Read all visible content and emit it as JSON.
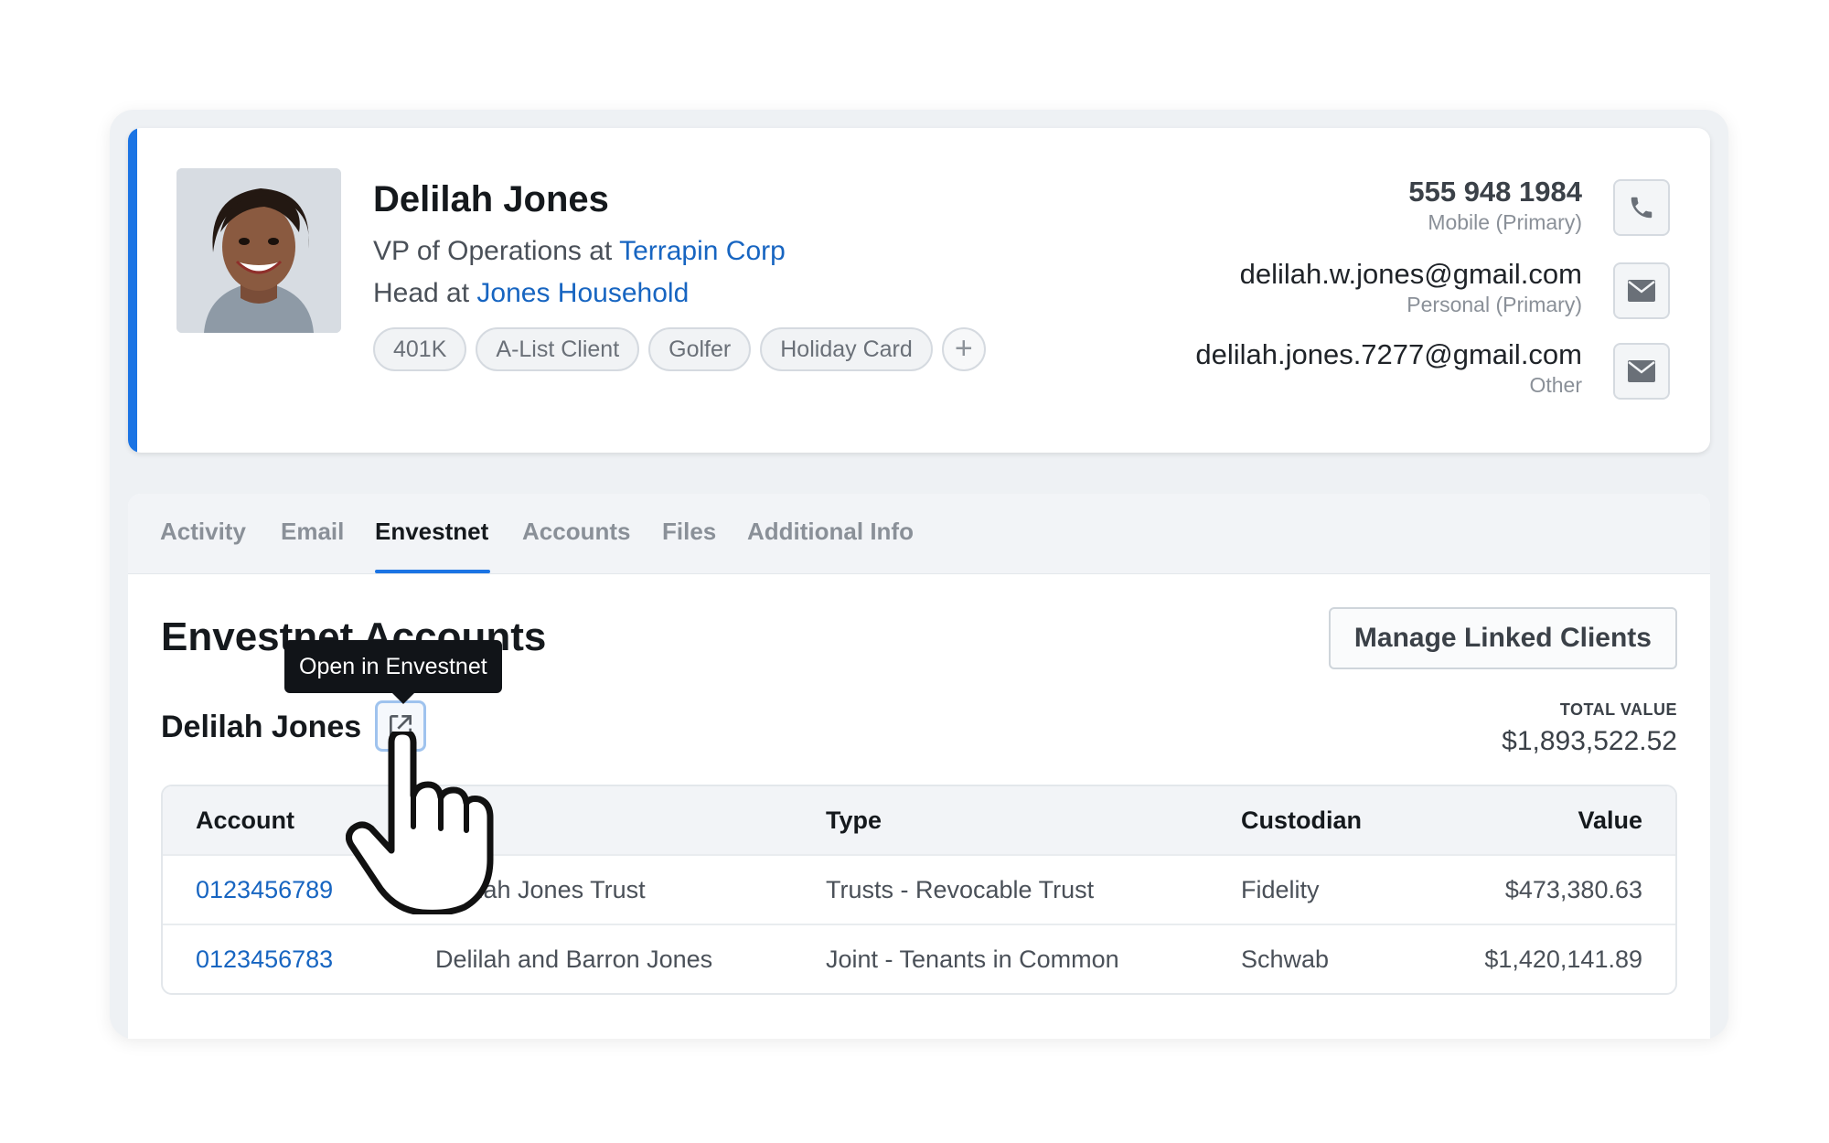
{
  "contact": {
    "name": "Delilah Jones",
    "title_prefix": "VP of Operations at",
    "company": "Terrapin Corp",
    "household_prefix": "Head at",
    "household": "Jones Household",
    "tags": [
      "401K",
      "A-List Client",
      "Golfer",
      "Holiday Card"
    ],
    "add_tag_icon": "plus-icon",
    "phone": {
      "value": "555 948 1984",
      "label": "Mobile (Primary)",
      "icon": "phone-icon"
    },
    "email_primary": {
      "value": "delilah.w.jones@gmail.com",
      "label": "Personal (Primary)",
      "icon": "mail-icon"
    },
    "email_other": {
      "value": "delilah.jones.7277@gmail.com",
      "label": "Other",
      "icon": "mail-icon"
    }
  },
  "tabs": [
    "Activity",
    "Email",
    "Envestnet",
    "Accounts",
    "Files",
    "Additional Info"
  ],
  "active_tab": "Envestnet",
  "envestnet": {
    "section_title": "Envestnet Accounts",
    "manage_button": "Manage Linked Clients",
    "client_name": "Delilah Jones",
    "open_tooltip": "Open in Envestnet",
    "open_icon": "external-link-icon",
    "total_label": "TOTAL VALUE",
    "total_value": "$1,893,522.52",
    "table": {
      "headers": [
        "Account",
        "",
        "Type",
        "Custodian",
        "Value"
      ],
      "rows": [
        [
          "0123456789",
          "Delilah Jones Trust",
          "Trusts - Revocable Trust",
          "Fidelity",
          "$473,380.63"
        ],
        [
          "0123456783",
          "Delilah and Barron Jones",
          "Joint - Tenants in Common",
          "Schwab",
          "$1,420,141.89"
        ]
      ]
    }
  },
  "cursor_icon": "hand-pointer-cursor",
  "colors": {
    "accent": "#1b74e4",
    "link": "#1765c1",
    "tooltip_bg": "#111418"
  }
}
